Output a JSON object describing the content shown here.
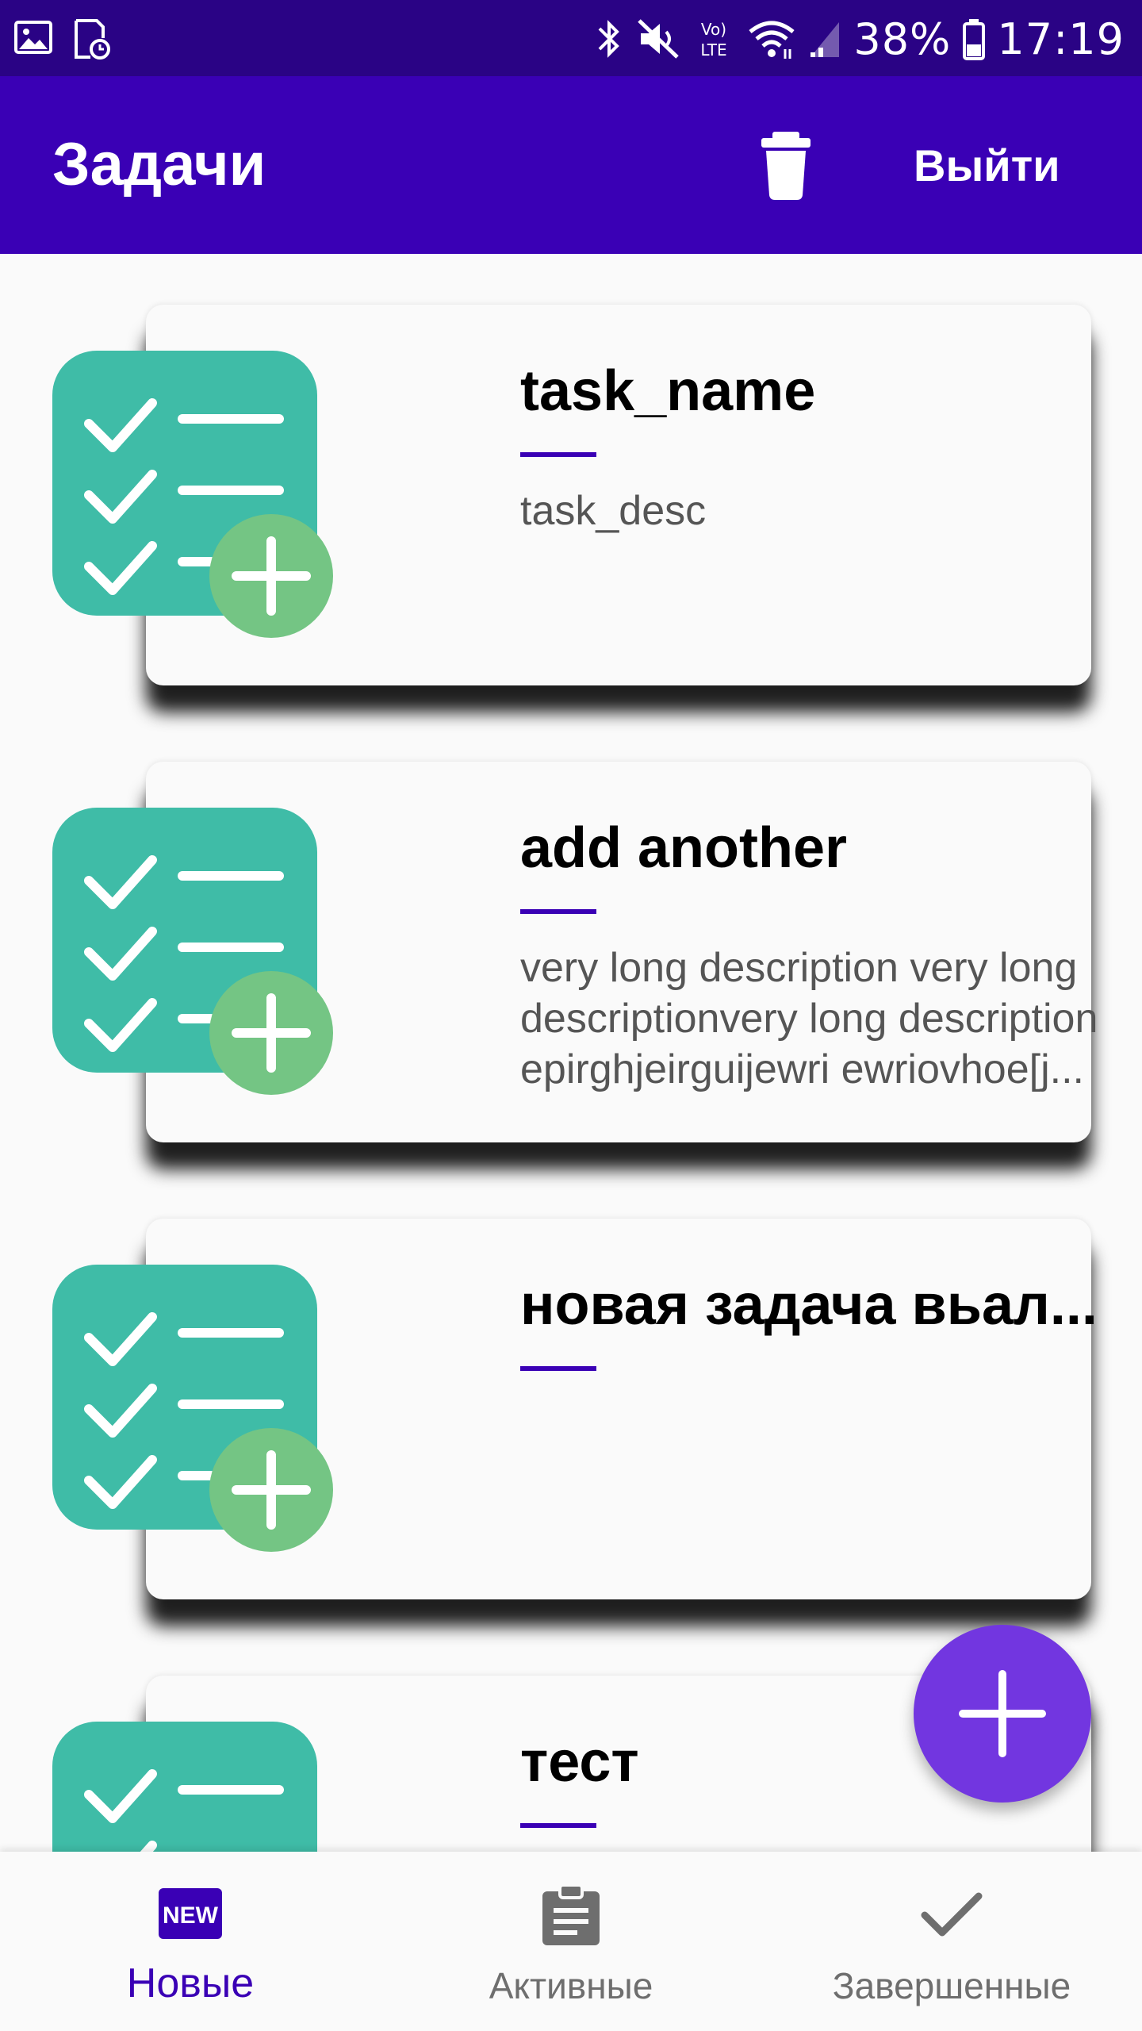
{
  "status_bar": {
    "battery": "38%",
    "time": "17:19",
    "network": "Vo) LTE",
    "left_icons": [
      "gallery-icon",
      "file-clock-icon"
    ],
    "right_icons": [
      "bluetooth-icon",
      "mute-icon",
      "volte-icon",
      "wifi-icon",
      "signal-icon",
      "battery-icon"
    ]
  },
  "app_bar": {
    "title": "Задачи",
    "delete_icon": "trash-icon",
    "logout_label": "Выйти",
    "color": "#3a00b5"
  },
  "tasks": [
    {
      "title": "task_name",
      "description": "task_desc"
    },
    {
      "title": "add another",
      "description": "very long description very long descriptionvery long description epirghjeirguijewri ewriovhoe[j..."
    },
    {
      "title": "новая задача вьал...",
      "description": ""
    },
    {
      "title": "тест",
      "description": ""
    }
  ],
  "task_icon": {
    "name": "checklist-add-icon",
    "body_color": "#3fbca7",
    "badge_color": "#74c584"
  },
  "fab": {
    "icon": "plus-icon",
    "color": "#7236e0"
  },
  "bottom_nav": {
    "items": [
      {
        "label": "Новые",
        "icon": "new-badge-icon",
        "active": true
      },
      {
        "label": "Активные",
        "icon": "clipboard-icon",
        "active": false
      },
      {
        "label": "Завершенные",
        "icon": "checkmark-icon",
        "active": false
      }
    ],
    "active_color": "#3a00b5"
  },
  "new_badge_text": "NEW"
}
